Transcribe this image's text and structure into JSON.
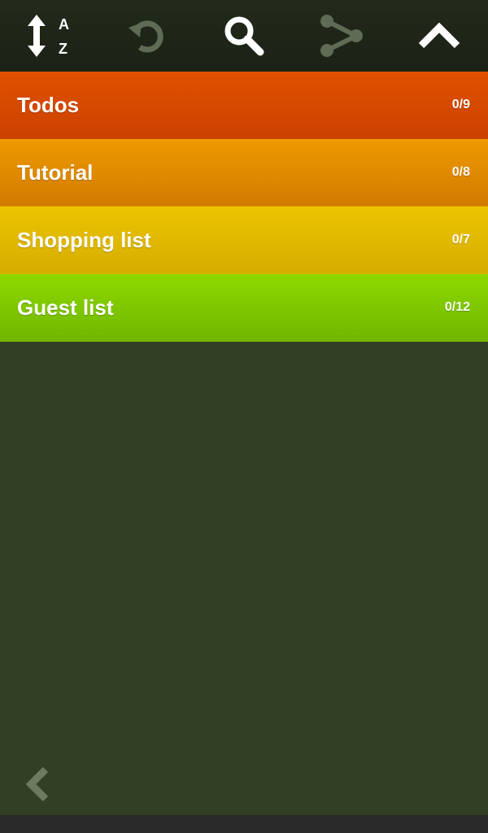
{
  "toolbar": {
    "icons": [
      "sort-az-icon",
      "undo-icon",
      "search-icon",
      "share-icon",
      "chevron-up-icon"
    ],
    "sort_letter_top": "A",
    "sort_letter_bottom": "Z"
  },
  "lists": [
    {
      "name": "Todos",
      "count": "0/9",
      "color": "#e05200"
    },
    {
      "name": "Tutorial",
      "count": "0/8",
      "color": "#ee9a00"
    },
    {
      "name": "Shopping list",
      "count": "0/7",
      "color": "#ecc400"
    },
    {
      "name": "Guest list",
      "count": "0/12",
      "color": "#8ed800"
    }
  ],
  "footer": {
    "back_icon": "chevron-left-icon"
  }
}
